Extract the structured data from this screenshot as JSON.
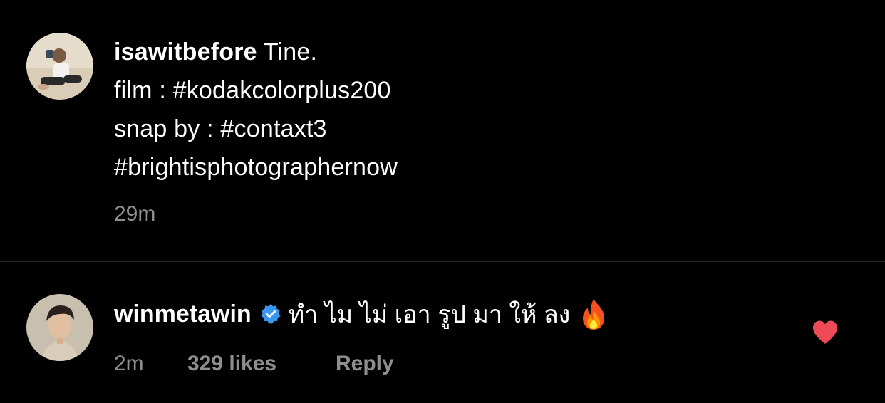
{
  "caption": {
    "avatar_icon": "user-avatar-icon",
    "username": "isawitbefore",
    "text_after_username": " Tine.",
    "lines": [
      "film : #kodakcolorplus200",
      "snap by : #contaxt3",
      "#brightisphotographernow"
    ],
    "time": "29m"
  },
  "comment": {
    "avatar_icon": "user-avatar-icon",
    "username": "winmetawin",
    "verified_icon": "verified-badge-icon",
    "text": "ทำ ไม ไม่ เอา รูป มา ให้ ลง",
    "emoji_icon": "fire-emoji-icon",
    "time": "2m",
    "likes": "329 likes",
    "reply_label": "Reply",
    "like_icon": "heart-icon",
    "liked": true
  },
  "colors": {
    "background": "#000000",
    "text": "#ffffff",
    "muted": "#8e8e8e",
    "heart": "#ed4956",
    "verified": "#3897f0"
  }
}
